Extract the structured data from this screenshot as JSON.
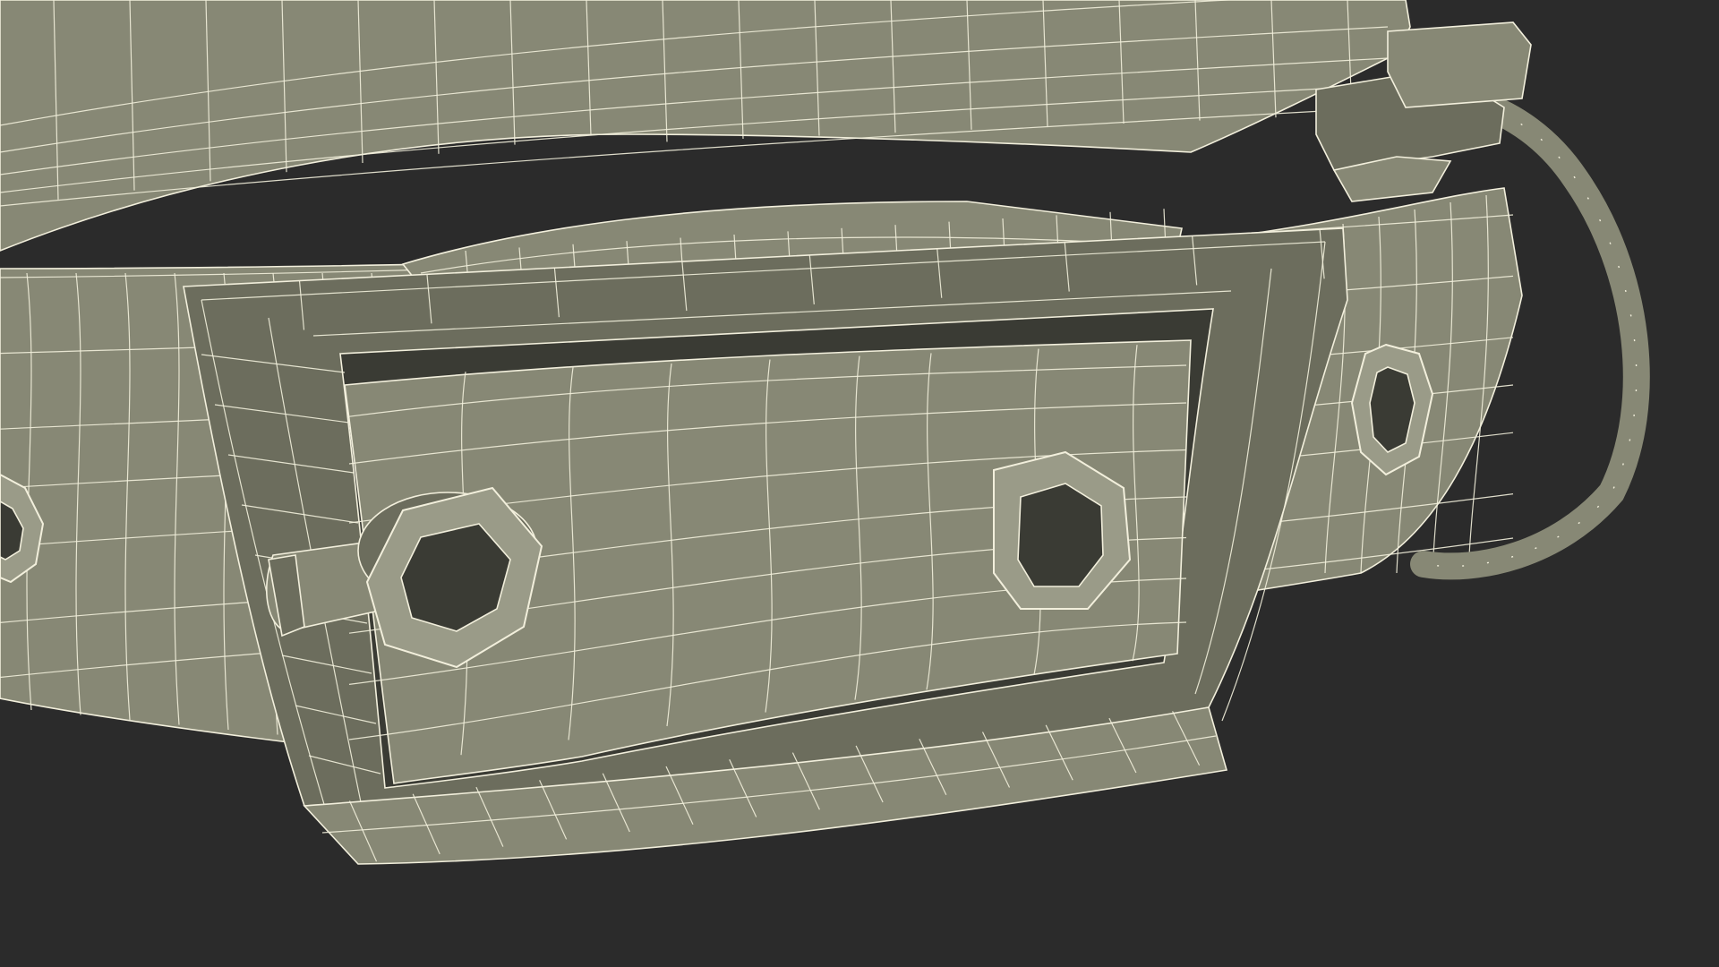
{
  "render": {
    "background_color": "#2b2b2b",
    "surface_color": "#878875",
    "surface_dark_color": "#6c6d5d",
    "surface_light_color": "#9a9b88",
    "wire_color": "#f2efdc",
    "hole_color": "#3a3b34"
  }
}
